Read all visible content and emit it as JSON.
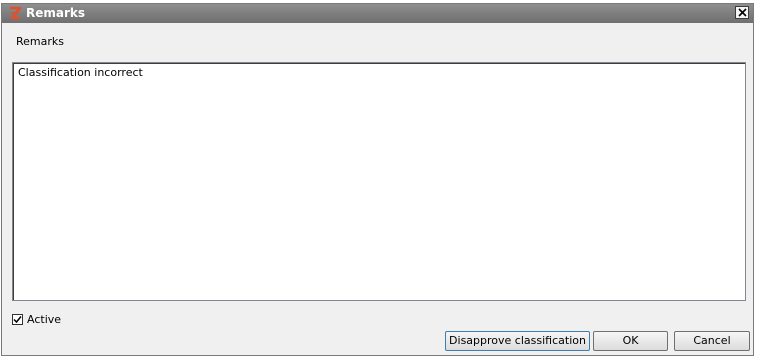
{
  "dialog": {
    "title": "Remarks",
    "close_glyph": "✕"
  },
  "form": {
    "remarks_label": "Remarks",
    "remarks_value": "Classification incorrect",
    "active_label": "Active",
    "active_checked": true
  },
  "buttons": {
    "disapprove_label": "Disapprove classification",
    "ok_label": "OK",
    "cancel_label": "Cancel"
  },
  "colors": {
    "titlebar": "#7f7f7f",
    "app_icon": "#e0502a",
    "dialog_bg": "#f0f0f0"
  }
}
